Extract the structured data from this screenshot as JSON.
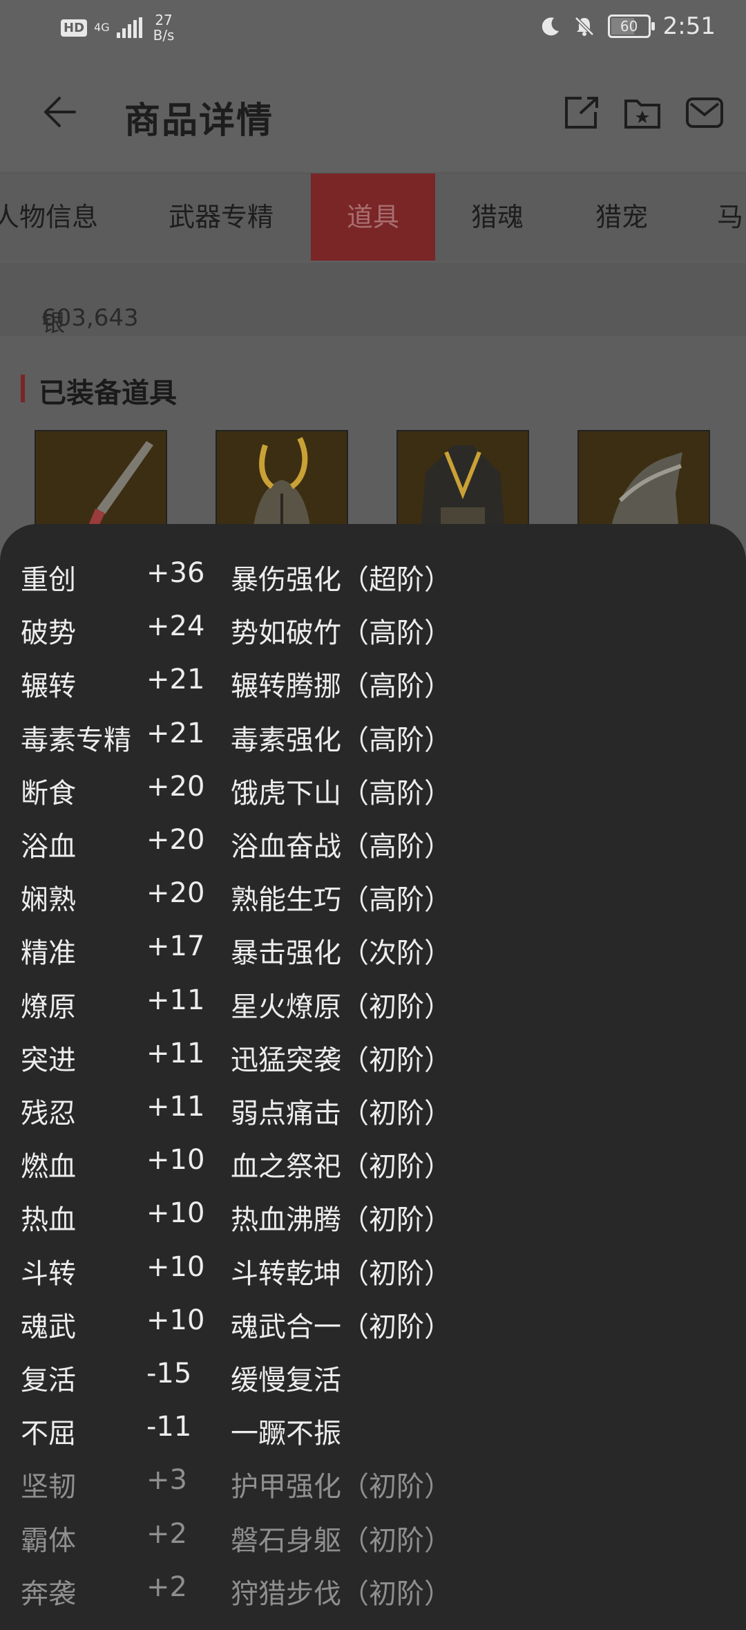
{
  "status_bar": {
    "hd": "HD",
    "network": "4G",
    "speed_value": "27",
    "speed_unit": "B/s",
    "battery": "60",
    "time": "2:51"
  },
  "header": {
    "title": "商品详情"
  },
  "tabs": [
    "人物信息",
    "武器专精",
    "道具",
    "猎魂",
    "猎宠",
    "马"
  ],
  "active_tab": "道具",
  "currency": {
    "label": "银币：",
    "value": "603,643"
  },
  "equipped": {
    "title": "已装备道具",
    "items": [
      "weapon",
      "helmet",
      "armor",
      "shoulder"
    ]
  },
  "stats": [
    {
      "name": "重创",
      "value": "+36",
      "effect": "暴伤强化（超阶）",
      "dim": false
    },
    {
      "name": "破势",
      "value": "+24",
      "effect": "势如破竹（高阶）",
      "dim": false
    },
    {
      "name": "辗转",
      "value": "+21",
      "effect": "辗转腾挪（高阶）",
      "dim": false
    },
    {
      "name": "毒素专精",
      "value": "+21",
      "effect": "毒素强化（高阶）",
      "dim": false
    },
    {
      "name": "断食",
      "value": "+20",
      "effect": "饿虎下山（高阶）",
      "dim": false
    },
    {
      "name": "浴血",
      "value": "+20",
      "effect": "浴血奋战（高阶）",
      "dim": false
    },
    {
      "name": "娴熟",
      "value": "+20",
      "effect": "熟能生巧（高阶）",
      "dim": false
    },
    {
      "name": "精准",
      "value": "+17",
      "effect": "暴击强化（次阶）",
      "dim": false
    },
    {
      "name": "燎原",
      "value": "+11",
      "effect": "星火燎原（初阶）",
      "dim": false
    },
    {
      "name": "突进",
      "value": "+11",
      "effect": "迅猛突袭（初阶）",
      "dim": false
    },
    {
      "name": "残忍",
      "value": "+11",
      "effect": "弱点痛击（初阶）",
      "dim": false
    },
    {
      "name": "燃血",
      "value": "+10",
      "effect": "血之祭祀（初阶）",
      "dim": false
    },
    {
      "name": "热血",
      "value": "+10",
      "effect": "热血沸腾（初阶）",
      "dim": false
    },
    {
      "name": "斗转",
      "value": "+10",
      "effect": "斗转乾坤（初阶）",
      "dim": false
    },
    {
      "name": "魂武",
      "value": "+10",
      "effect": "魂武合一（初阶）",
      "dim": false
    },
    {
      "name": "复活",
      "value": "-15",
      "effect": "缓慢复活",
      "dim": false
    },
    {
      "name": "不屈",
      "value": "-11",
      "effect": "一蹶不振",
      "dim": false
    },
    {
      "name": "坚韧",
      "value": "+3",
      "effect": "护甲强化（初阶）",
      "dim": true
    },
    {
      "name": "霸体",
      "value": "+2",
      "effect": "磐石身躯（初阶）",
      "dim": true
    },
    {
      "name": "奔袭",
      "value": "+2",
      "effect": "狩猎步伐（初阶）",
      "dim": true
    }
  ]
}
